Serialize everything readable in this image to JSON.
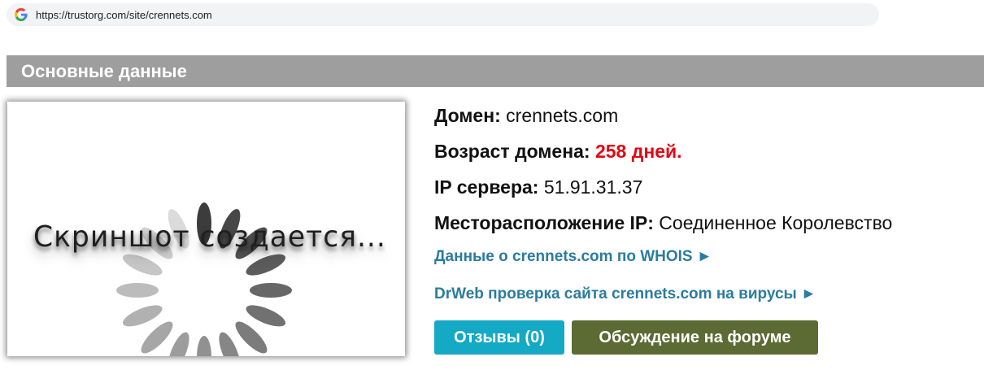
{
  "browser": {
    "url": "https://trustorg.com/site/crennets.com",
    "icon": "google-g-icon"
  },
  "section": {
    "title": "Основные данные"
  },
  "screenshot": {
    "text": "Скриншот создается..."
  },
  "info": {
    "domain_label": "Домен:",
    "domain_value": "crennets.com",
    "age_label": "Возраст домена:",
    "age_value": "258 дней.",
    "ip_label": "IP сервера:",
    "ip_value": "51.91.31.37",
    "location_label": "Месторасположение IP:",
    "location_value": "Соединенное Королевство"
  },
  "links": {
    "whois": "Данные о crennets.com по WHOIS ►",
    "drweb": "DrWeb проверка сайта crennets.com на вирусы ►"
  },
  "buttons": {
    "reviews": "Отзывы (0)",
    "forum": "Обсуждение на форуме"
  },
  "colors": {
    "header_bg": "#9e9e9e",
    "age_red": "#e30613",
    "link_blue": "#2b7c9e",
    "reviews_btn": "#14a9c4",
    "forum_btn": "#5b6b33"
  }
}
